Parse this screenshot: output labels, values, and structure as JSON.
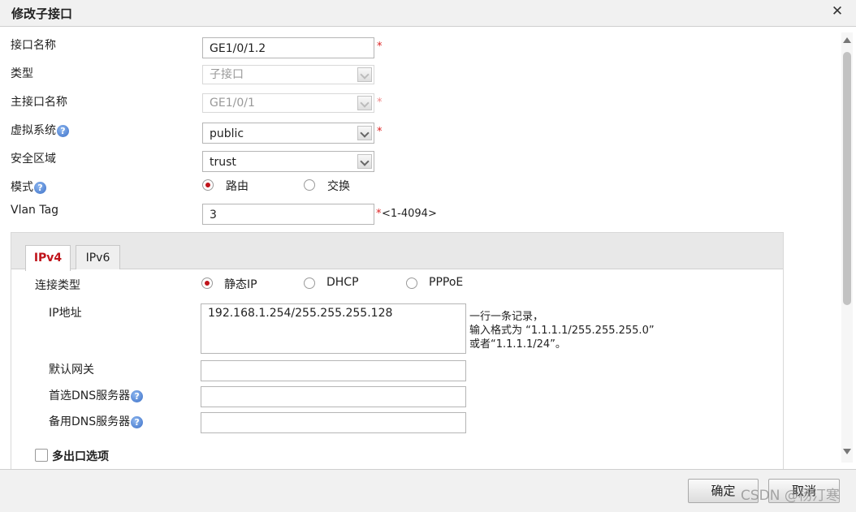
{
  "dialog": {
    "title": "修改子接口"
  },
  "form": {
    "interface_name": {
      "label": "接口名称",
      "value": "GE1/0/1.2"
    },
    "type": {
      "label": "类型",
      "value": "子接口"
    },
    "main_interface": {
      "label": "主接口名称",
      "value": "GE1/0/1"
    },
    "vsys": {
      "label": "虚拟系统",
      "value": "public"
    },
    "zone": {
      "label": "安全区域",
      "value": "trust"
    },
    "mode": {
      "label": "模式",
      "options": [
        "路由",
        "交换"
      ],
      "selected": "路由"
    },
    "vlan_tag": {
      "label": "Vlan Tag",
      "value": "3",
      "range": "<1-4094>"
    },
    "required_mark": "*",
    "help_glyph": "?"
  },
  "tabs": [
    {
      "label": "IPv4",
      "active": true
    },
    {
      "label": "IPv6",
      "active": false
    }
  ],
  "ipv4": {
    "conn_type": {
      "label": "连接类型",
      "options": [
        "静态IP",
        "DHCP",
        "PPPoE"
      ],
      "selected": "静态IP"
    },
    "ip_address": {
      "label": "IP地址",
      "value": "192.168.1.254/255.255.255.128",
      "hint": [
        "一行一条记录，",
        "输入格式为 “1.1.1.1/255.255.255.0”",
        "或者“1.1.1.1/24”。"
      ]
    },
    "gateway": {
      "label": "默认网关",
      "value": ""
    },
    "primary_dns": {
      "label": "首选DNS服务器",
      "value": ""
    },
    "secondary_dns": {
      "label": "备用DNS服务器",
      "value": ""
    },
    "multi_exit": {
      "label": "多出口选项",
      "checked": false
    }
  },
  "footer": {
    "ok_label": "确定",
    "cancel_label": "取消"
  },
  "watermark": "CSDN @杨汀寒",
  "colors": {
    "accent": "#c0141b",
    "required": "#dd2222",
    "help": "#3b6fc7"
  }
}
